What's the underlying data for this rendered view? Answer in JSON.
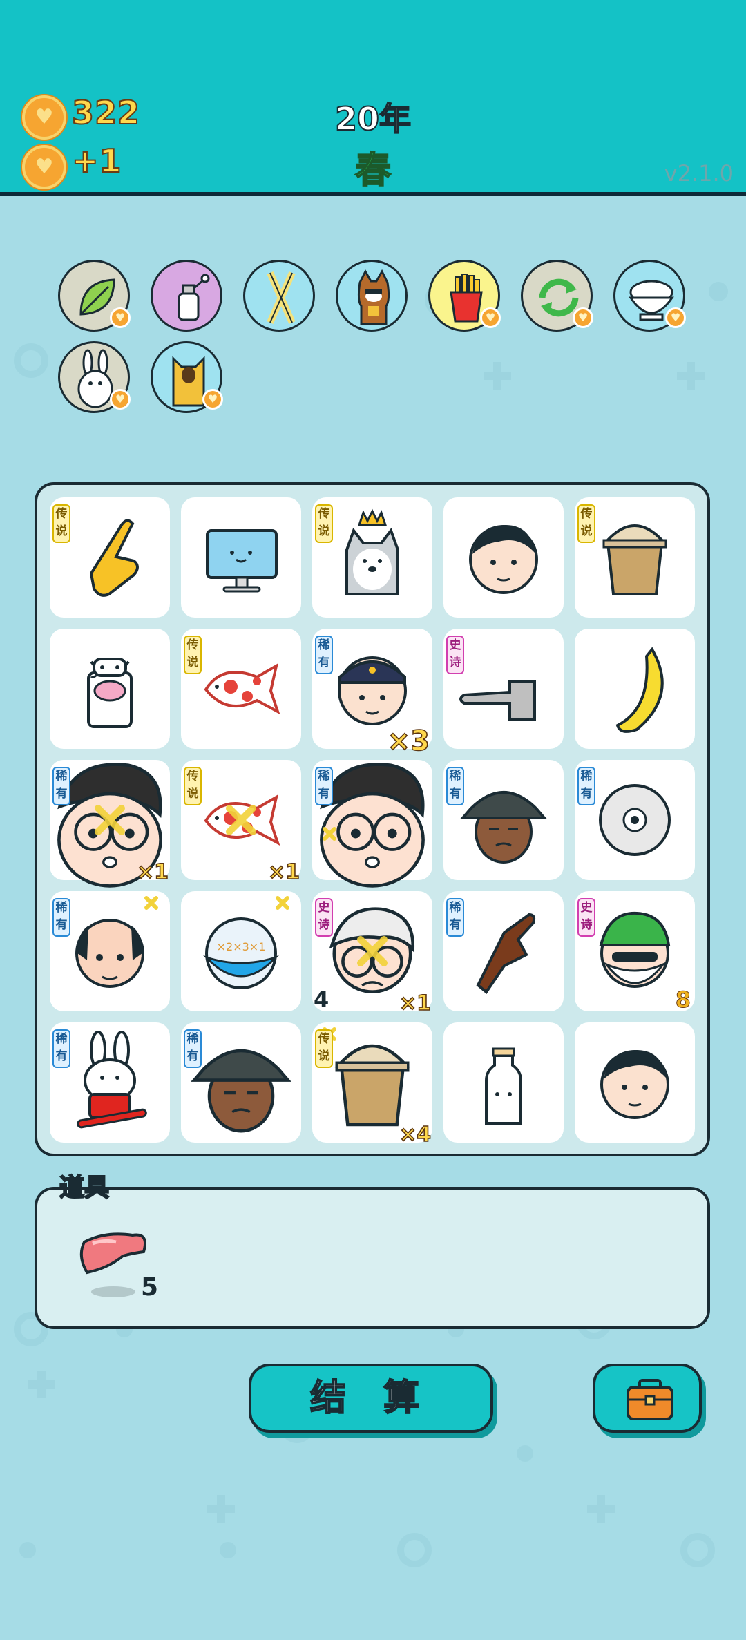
{
  "header": {
    "coins": "322",
    "income": "+1",
    "year": "20年",
    "season": "春",
    "version": "v2.1.0"
  },
  "buffs": [
    {
      "name": "leaf",
      "color": "#d9d9c7",
      "badge": true
    },
    {
      "name": "perfume-bottle",
      "color": "#d8a8e2",
      "badge": false
    },
    {
      "name": "crossed-straws",
      "color": "#9fe2f0",
      "badge": false
    },
    {
      "name": "husky-dog",
      "color": "#9fe2f0",
      "badge": false
    },
    {
      "name": "french-fries",
      "color": "#faf48d",
      "badge": true
    },
    {
      "name": "refresh-arrows",
      "color": "#d9d9c7",
      "badge": true
    },
    {
      "name": "rice-bowl",
      "color": "#9fe2f0",
      "badge": true
    },
    {
      "name": "white-rabbit",
      "color": "#d9d9c7",
      "badge": true
    },
    {
      "name": "orange-cat",
      "color": "#9fe2f0",
      "badge": true
    }
  ],
  "rarity_labels": {
    "legendary": "传说",
    "epic": "史诗",
    "rare": "稀有"
  },
  "board": [
    [
      {
        "item": "pointing-hand",
        "rarity": "legendary"
      },
      {
        "item": "computer-monitor",
        "rarity": ""
      },
      {
        "item": "husky-king",
        "rarity": "legendary"
      },
      {
        "item": "man-face",
        "rarity": ""
      },
      {
        "item": "bubble-tea",
        "rarity": "legendary"
      }
    ],
    [
      {
        "item": "cow",
        "rarity": ""
      },
      {
        "item": "koi-fish",
        "rarity": "legendary"
      },
      {
        "item": "police-officer",
        "rarity": "rare",
        "mult": "×3"
      },
      {
        "item": "stone-hand",
        "rarity": "epic"
      },
      {
        "item": "banana",
        "rarity": ""
      }
    ],
    [
      {
        "item": "glasses-boy",
        "rarity": "rare",
        "mult": "×1",
        "crossed": true
      },
      {
        "item": "koi-fish",
        "rarity": "legendary",
        "mult": "×1",
        "crossed": true
      },
      {
        "item": "glasses-boy",
        "rarity": "rare",
        "small_x": true
      },
      {
        "item": "bucket-hat-man",
        "rarity": "rare"
      },
      {
        "item": "cd-disc",
        "rarity": "rare"
      }
    ],
    [
      {
        "item": "bald-man",
        "rarity": "rare",
        "small_x": true
      },
      {
        "item": "math-ball",
        "rarity": "",
        "small_x": true
      },
      {
        "item": "grandpa",
        "rarity": "epic",
        "num": "4",
        "mult": "×1",
        "crossed": true
      },
      {
        "item": "chocolate-hand",
        "rarity": "rare"
      },
      {
        "item": "green-hair-grandpa",
        "rarity": "epic",
        "num": "8"
      }
    ],
    [
      {
        "item": "rabbit-skateboard",
        "rarity": "rare"
      },
      {
        "item": "bucket-hat-man",
        "rarity": "rare"
      },
      {
        "item": "bubble-tea",
        "rarity": "legendary",
        "mult": "×4",
        "small_x": true
      },
      {
        "item": "milk-bottle",
        "rarity": ""
      },
      {
        "item": "man-face",
        "rarity": ""
      }
    ]
  ],
  "items_panel": {
    "title": "道具",
    "item": "liver",
    "count": "5"
  },
  "settle_button": "结 算",
  "bag_button": "briefcase-icon"
}
